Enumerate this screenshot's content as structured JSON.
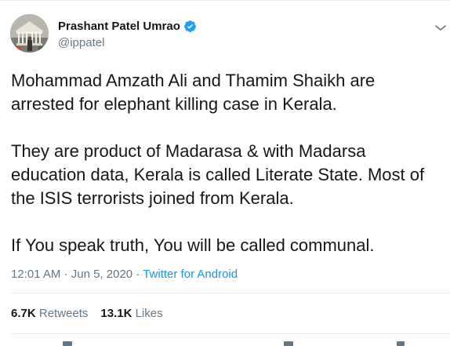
{
  "author": {
    "display_name": "Prashant Patel Umrao",
    "handle": "@ippatel",
    "verified": true,
    "avatar_icon": "avatar-photo"
  },
  "tweet": {
    "paragraphs": [
      "Mohammad Amzath Ali and Thamim Shaikh are arrested for elephant killing case in Kerala.",
      "They are product of Madarasa & with Madarsa education data, Kerala is called Literate State. Most of the ISIS terrorists joined from Kerala.",
      "If You speak truth, You will be called communal."
    ],
    "time": "12:01 AM",
    "date": "Jun 5, 2020",
    "separator": "·",
    "source": "Twitter for Android"
  },
  "stats": {
    "retweets_count": "6.7K",
    "retweets_label": "Retweets",
    "likes_count": "13.1K",
    "likes_label": "Likes"
  },
  "colors": {
    "text": "#14171a",
    "secondary": "#657786",
    "link": "#1b95e0",
    "verified_badge": "#1da1f2",
    "divider": "#e6ecf0"
  }
}
